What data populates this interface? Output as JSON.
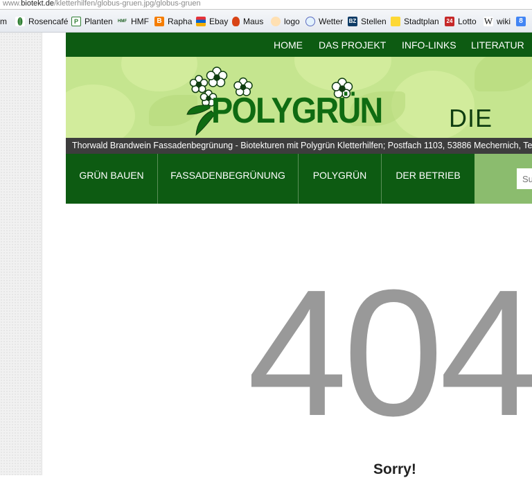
{
  "browser": {
    "url_prefix": "www.",
    "url_domain": "biotekt.de",
    "url_path": "/kletterhilfen/globus-gruen.jpg/globus-gruen",
    "bookmarks": [
      {
        "label": "m",
        "icon": "page-icon"
      },
      {
        "label": "Rosencafé",
        "icon": "leaf-icon"
      },
      {
        "label": "Planten",
        "icon": "p-icon"
      },
      {
        "label": "HMF",
        "icon": "hmf-icon"
      },
      {
        "label": "Rapha",
        "icon": "blogger-icon"
      },
      {
        "label": "Ebay",
        "icon": "bag-icon"
      },
      {
        "label": "Maus",
        "icon": "mouse-icon"
      },
      {
        "label": "logo",
        "icon": "smiley-icon"
      },
      {
        "label": "Wetter",
        "icon": "globe-icon"
      },
      {
        "label": "Stellen",
        "icon": "bz-icon"
      },
      {
        "label": "Stadtplan",
        "icon": "note-icon"
      },
      {
        "label": "Lotto",
        "icon": "lotto-icon"
      },
      {
        "label": "wiki",
        "icon": "wikipedia-icon"
      },
      {
        "label": "",
        "icon": "google-icon"
      }
    ],
    "bookmark_icon_text": {
      "p": "P",
      "hmf": "HMF",
      "blogger": "B",
      "bz": "BZ",
      "lotto": "24",
      "wiki": "W",
      "google": "8"
    }
  },
  "site": {
    "top_nav": [
      "HOME",
      "DAS PROJEKT",
      "INFO-LINKS",
      "LITERATUR"
    ],
    "logo_text": "POLYGRÜN",
    "tagline": "DIE KL",
    "address": "Thorwald Brandwein Fassadenbegrünung - Biotekturen mit Polygrün Kletterhilfen; Postfach 1103, 53886 Mechernich, Tel.:",
    "main_nav": [
      "GRÜN BAUEN",
      "FASSADENBEGRÜNUNG",
      "POLYGRÜN",
      "DER BETRIEB"
    ],
    "search_placeholder": "Su",
    "error_code": "404",
    "error_title": "Sorry!"
  },
  "colors": {
    "nav_green": "#0d5b12",
    "banner_green": "#c5e58f",
    "search_green": "#8bbc6e",
    "error_gray": "#999999"
  }
}
